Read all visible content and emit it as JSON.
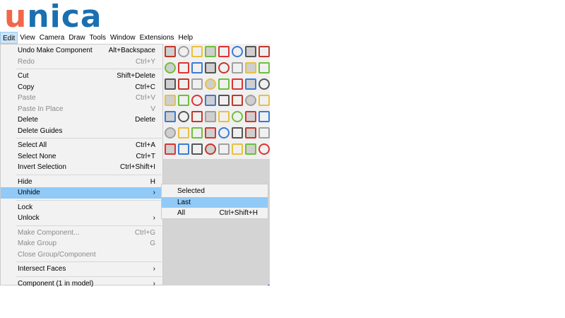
{
  "logo": {
    "text_orange": "u",
    "text_blue": "nica"
  },
  "menubar": [
    "Edit",
    "View",
    "Camera",
    "Draw",
    "Tools",
    "Window",
    "Extensions",
    "Help"
  ],
  "edit_menu": [
    {
      "label": "Undo Make Component",
      "shortcut": "Alt+Backspace",
      "enabled": true
    },
    {
      "label": "Redo",
      "shortcut": "Ctrl+Y",
      "enabled": false,
      "sep_after": true
    },
    {
      "label": "Cut",
      "shortcut": "Shift+Delete",
      "enabled": true
    },
    {
      "label": "Copy",
      "shortcut": "Ctrl+C",
      "enabled": true
    },
    {
      "label": "Paste",
      "shortcut": "Ctrl+V",
      "enabled": false
    },
    {
      "label": "Paste In Place",
      "shortcut": "V",
      "enabled": false
    },
    {
      "label": "Delete",
      "shortcut": "Delete",
      "enabled": true
    },
    {
      "label": "Delete Guides",
      "shortcut": "",
      "enabled": true,
      "sep_after": true
    },
    {
      "label": "Select All",
      "shortcut": "Ctrl+A",
      "enabled": true
    },
    {
      "label": "Select None",
      "shortcut": "Ctrl+T",
      "enabled": true
    },
    {
      "label": "Invert Selection",
      "shortcut": "Ctrl+Shift+I",
      "enabled": true,
      "sep_after": true
    },
    {
      "label": "Hide",
      "shortcut": "H",
      "enabled": true
    },
    {
      "label": "Unhide",
      "shortcut": "›",
      "enabled": true,
      "highlighted": true,
      "sep_after": true
    },
    {
      "label": "Lock",
      "shortcut": "",
      "enabled": true
    },
    {
      "label": "Unlock",
      "shortcut": "›",
      "enabled": true,
      "sep_after": true
    },
    {
      "label": "Make Component...",
      "shortcut": "Ctrl+G",
      "enabled": false
    },
    {
      "label": "Make Group",
      "shortcut": "G",
      "enabled": false
    },
    {
      "label": "Close Group/Component",
      "shortcut": "",
      "enabled": false,
      "sep_after": true
    },
    {
      "label": "Intersect Faces",
      "shortcut": "›",
      "enabled": true,
      "sep_after": true
    },
    {
      "label": "Component (1 in model)",
      "shortcut": "›",
      "enabled": true
    }
  ],
  "unhide_submenu": [
    {
      "label": "Selected",
      "shortcut": ""
    },
    {
      "label": "Last",
      "shortcut": "",
      "highlighted": true
    },
    {
      "label": "All",
      "shortcut": "Ctrl+Shift+H"
    }
  ],
  "toolbar_colors": [
    "#c0392b",
    "#a0a0a0",
    "#e8c140",
    "#6fbf3a",
    "#d33",
    "#3a7bd5",
    "#555"
  ]
}
